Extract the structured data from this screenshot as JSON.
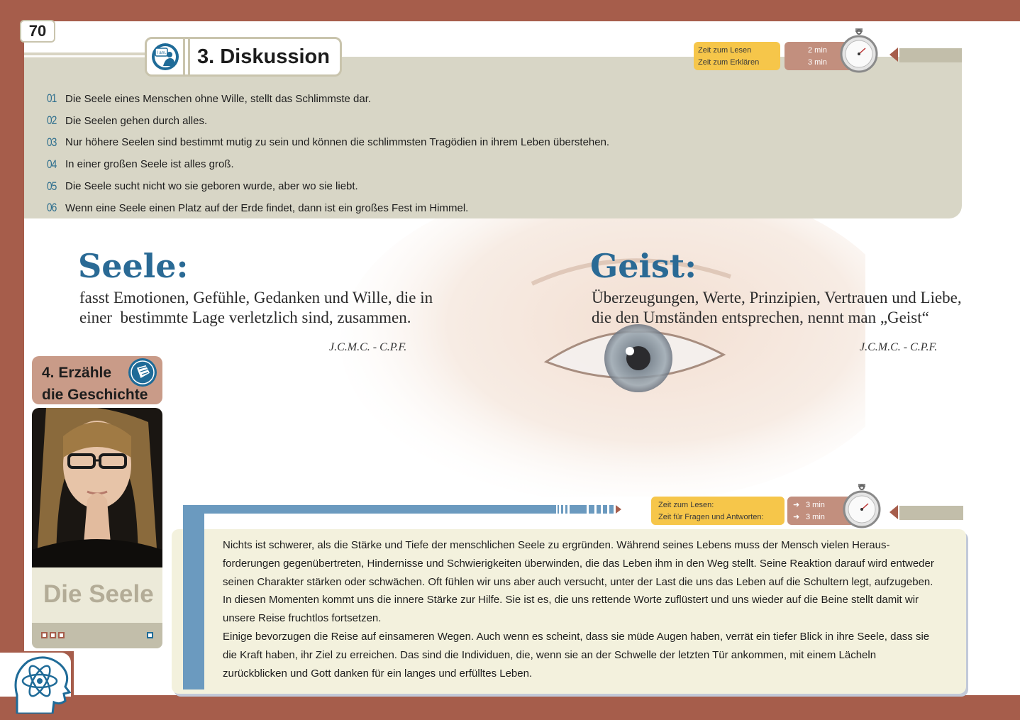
{
  "page_number": "70",
  "discussion": {
    "title": "3. Diskussion",
    "icon_label": "I am...",
    "time": {
      "label_read": "Zeit zum Lesen",
      "label_explain": "Zeit zum Erklären",
      "value_read": "2 min",
      "value_explain": "3 min"
    },
    "items": [
      {
        "num": "01",
        "text": "Die Seele eines Menschen ohne Wille, stellt das Schlimmste dar."
      },
      {
        "num": "02",
        "text": "Die Seelen gehen durch alles."
      },
      {
        "num": "03",
        "text": "Nur höhere Seelen sind bestimmt mutig zu sein und können die schlimmsten Tragödien in ihrem Leben überstehen."
      },
      {
        "num": "04",
        "text": "In einer großen Seele ist alles groß."
      },
      {
        "num": "05",
        "text": "Die Seele sucht nicht wo sie geboren wurde, aber wo sie liebt."
      },
      {
        "num": "06",
        "text": "Wenn eine Seele einen Platz auf der Erde findet, dann ist ein großes Fest im Himmel."
      }
    ]
  },
  "seele": {
    "title": "Seele:",
    "line1": "fasst Emotionen, Gefühle, Gedanken und Wille, die in",
    "line2": "einer  bestimmte Lage verletzlich sind, zusammen.",
    "signature": "J.C.M.C. - C.P.F."
  },
  "geist": {
    "title": "Geist:",
    "line1": "Überzeugungen, Werte, Prinzipien, Vertrauen und Liebe,",
    "line2": "die den Umständen entsprechen, nennt man „Geist“",
    "signature": "J.C.M.C. - C.P.F."
  },
  "story": {
    "header_line1": "4. Erzähle",
    "header_line2": "die Geschichte",
    "label": "Die Seele",
    "time": {
      "label_read": "Zeit zum Lesen:",
      "label_qa": "Zeit für Fragen und Antworten:",
      "value_read": "3 min",
      "value_qa": "3 min"
    },
    "paragraph1": "Nichts ist schwerer, als die Stärke und Tiefe der menschlichen Seele zu ergründen. Während seines Lebens muss der Mensch vielen Heraus-forderungen gegenübertreten, Hindernisse und Schwierigkeiten überwinden, die das Leben ihm in den Weg stellt. Seine Reaktion darauf wird entweder seinen Charakter stärken oder schwächen. Oft fühlen wir uns aber auch versucht, unter der Last die uns das Leben auf die Schultern legt, aufzugeben. In diesen Momenten kommt uns die innere Stärke zur Hilfe. Sie ist es, die uns rettende Worte zuflüstert und uns wieder auf die Beine stellt damit wir unsere Reise fruchtlos fortsetzen.",
    "paragraph2": "Einige bevorzugen die Reise auf einsameren Wegen. Auch wenn es scheint, dass sie müde Augen haben, verrät ein tiefer Blick in ihre Seele, dass sie die Kraft haben, ihr Ziel zu erreichen. Das sind die Individuen, die, wenn sie an der Schwelle der letzten Tür ankommen, mit einem Lächeln zurückblicken und Gott danken für ein langes und erfülltes Leben."
  },
  "colors": {
    "frame": "#a65d4b",
    "accent_blue": "#2a6a95",
    "panel": "#d8d6c6",
    "time_yellow": "#f6c64a"
  },
  "icons": [
    "person-speaking-icon",
    "stopwatch-icon",
    "book-icon",
    "atom-head-icon"
  ]
}
